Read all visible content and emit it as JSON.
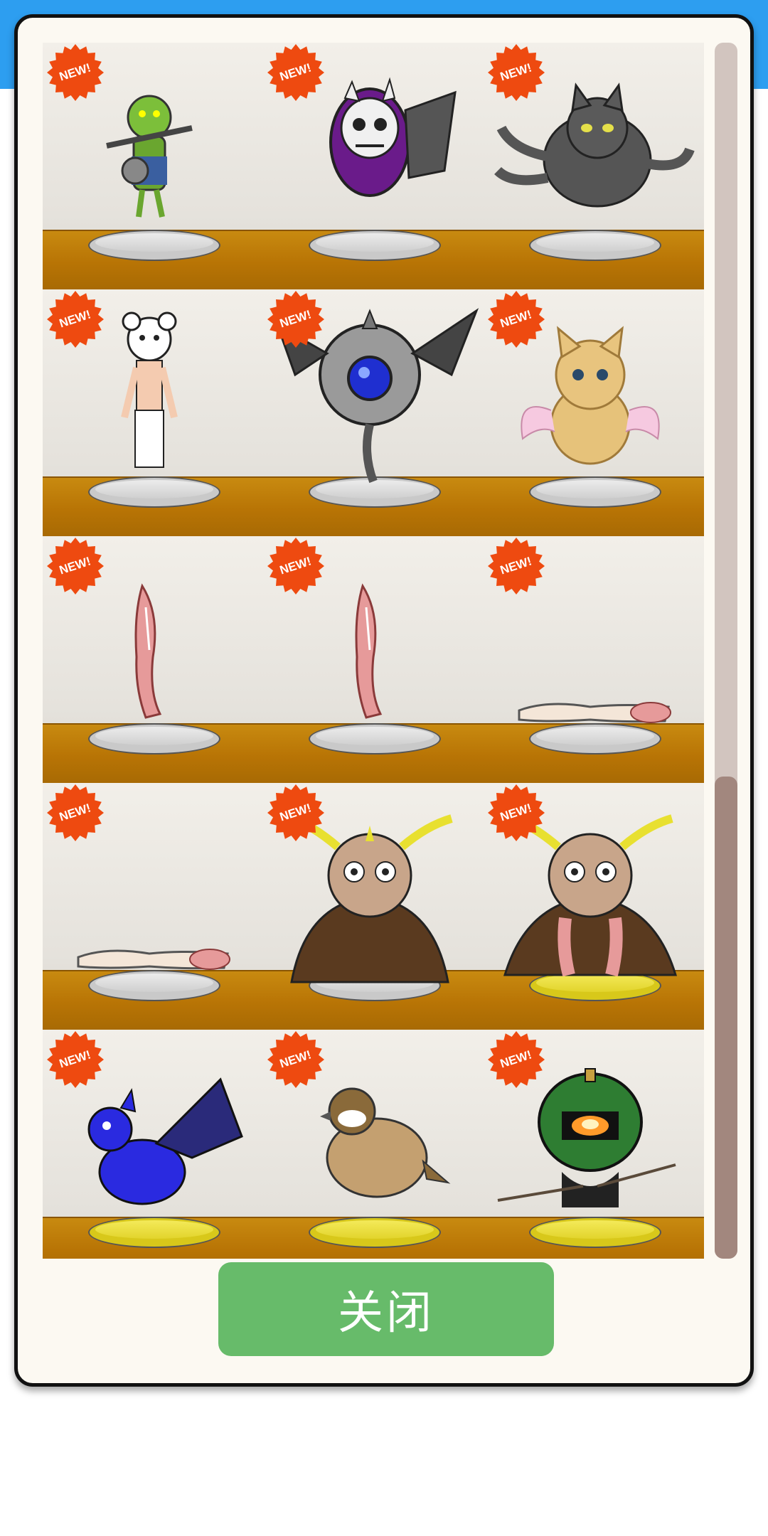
{
  "badge_text": "NEW!",
  "close_label": "关闭",
  "colors": {
    "header": "#2d9ef0",
    "close_button": "#67bb6a",
    "badge": "#ee4a10",
    "shelf_wood": "#b87405"
  },
  "shelves": [
    [
      {
        "id": "goblin",
        "pedestal": "silver"
      },
      {
        "id": "skull-shield",
        "pedestal": "silver"
      },
      {
        "id": "multi-tail-cat",
        "pedestal": "silver"
      }
    ],
    [
      {
        "id": "bear-mask-man",
        "pedestal": "silver"
      },
      {
        "id": "orb-bat",
        "pedestal": "silver"
      },
      {
        "id": "winged-kitten",
        "pedestal": "silver"
      }
    ],
    [
      {
        "id": "muscle-leg",
        "pedestal": "silver"
      },
      {
        "id": "muscle-leg",
        "pedestal": "silver"
      },
      {
        "id": "muscle-arm",
        "pedestal": "silver"
      }
    ],
    [
      {
        "id": "muscle-arm",
        "pedestal": "silver"
      },
      {
        "id": "antlered-owl-cloak",
        "pedestal": "silver"
      },
      {
        "id": "antlered-owl-full",
        "pedestal": "gold"
      }
    ],
    [
      {
        "id": "blue-dragon",
        "pedestal": "gold"
      },
      {
        "id": "sparrow",
        "pedestal": "gold"
      },
      {
        "id": "pumpkin-head",
        "pedestal": "gold"
      }
    ]
  ]
}
